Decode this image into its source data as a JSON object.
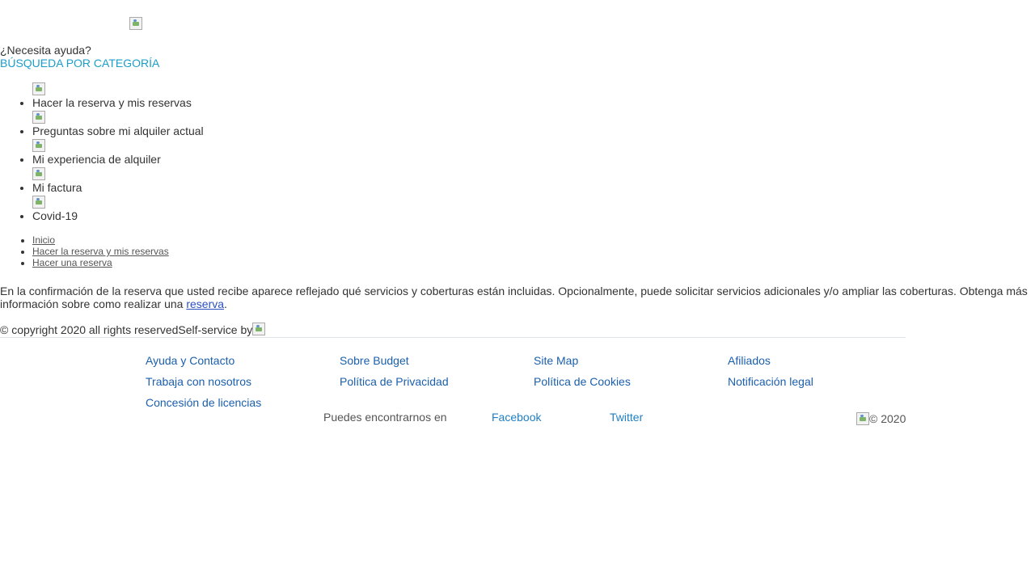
{
  "header": {
    "logo_icon": "budget-logo-broken-image"
  },
  "help": {
    "title": "¿Necesita ayuda?",
    "category_title": "BÚSQUEDA POR CATEGORÍA",
    "categories": [
      {
        "label": "Hacer la reserva y mis reservas",
        "icon": "broken-image-icon"
      },
      {
        "label": "Preguntas sobre mi alquiler actual",
        "icon": "broken-image-icon"
      },
      {
        "label": "Mi experiencia de alquiler",
        "icon": "broken-image-icon"
      },
      {
        "label": "Mi factura",
        "icon": "broken-image-icon"
      },
      {
        "label": "Covid-19",
        "icon": "broken-image-icon"
      }
    ]
  },
  "breadcrumb": [
    "Inicio",
    "Hacer la reserva y mis reservas",
    "Hacer una reserva"
  ],
  "article": {
    "text": "En la confirmación de la reserva que usted recibe aparece reflejado qué servicios y coberturas están incluidas. Opcionalmente, puede solicitar servicios adicionales y/o ampliar las coberturas. Obtenga más información sobre como realizar una ",
    "link": "reserva",
    "end": "."
  },
  "copyright": {
    "text": "© copyright 2020 all rights reservedSelf-service by"
  },
  "footer": {
    "links": [
      "Ayuda y Contacto",
      "Sobre Budget",
      "Site Map",
      "Afiliados",
      "Trabaja con nosotros",
      "Política de Privacidad",
      "Política de Cookies",
      "Notificación legal",
      "Concesión de licencias"
    ],
    "social_label": "Puedes encontrarnos en",
    "facebook": "Facebook",
    "twitter": "Twitter",
    "copy": "© 2020"
  },
  "colors": {
    "category_title": "#1a9fc9",
    "footer_link": "#1b5fad",
    "text": "#333333"
  }
}
